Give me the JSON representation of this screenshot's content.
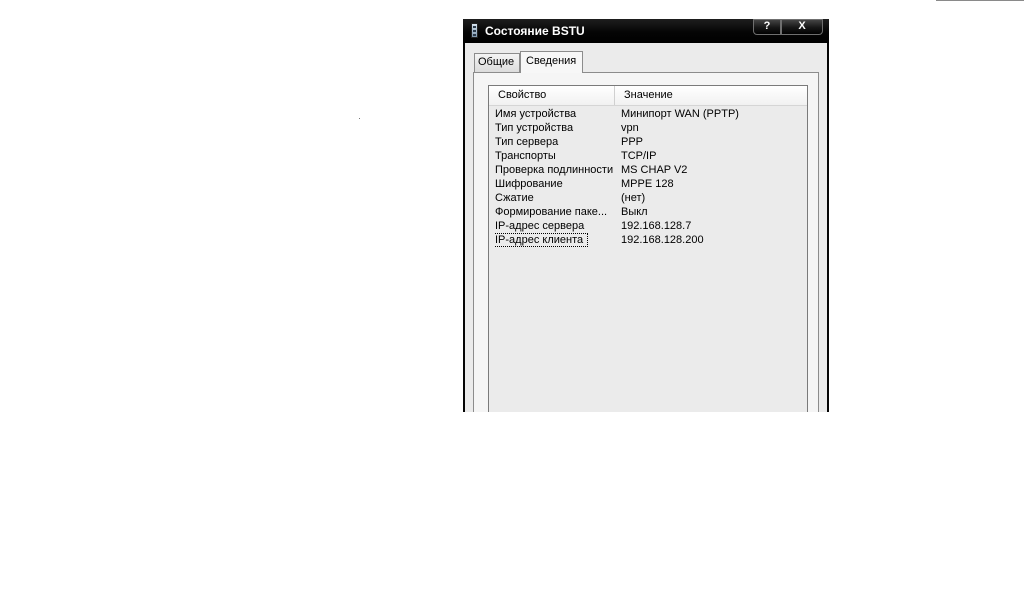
{
  "window": {
    "title": "Состояние BSTU",
    "help_label": "?",
    "close_label": "X"
  },
  "tabs": [
    {
      "label": "Общие",
      "selected": false
    },
    {
      "label": "Сведения",
      "selected": true
    }
  ],
  "details": {
    "columns": {
      "property": "Свойство",
      "value": "Значение"
    },
    "rows": [
      {
        "property": "Имя устройства",
        "value": "Минипорт WAN (PPTP)"
      },
      {
        "property": "Тип устройства",
        "value": "vpn"
      },
      {
        "property": "Тип сервера",
        "value": "PPP"
      },
      {
        "property": "Транспорты",
        "value": "TCP/IP"
      },
      {
        "property": "Проверка подлинности",
        "value": "MS CHAP V2"
      },
      {
        "property": "Шифрование",
        "value": "MPPE 128"
      },
      {
        "property": "Сжатие",
        "value": "(нет)"
      },
      {
        "property": "Формирование паке...",
        "value": "Выкл"
      },
      {
        "property": "IP-адрес сервера",
        "value": "192.168.128.7"
      },
      {
        "property": "IP-адрес клиента",
        "value": "192.168.128.200"
      }
    ]
  },
  "colors": {
    "titlebar": "#050505",
    "client": "#ebebeb",
    "list_background": "#ebebeb"
  }
}
